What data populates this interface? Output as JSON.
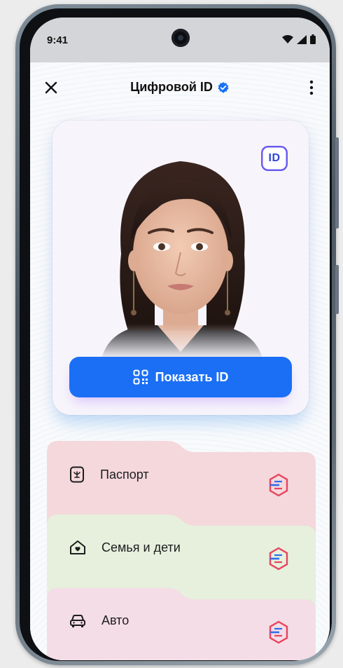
{
  "status": {
    "time": "9:41"
  },
  "header": {
    "title": "Цифровой ID"
  },
  "id_card": {
    "badge": "ID",
    "show_button_label": "Показать ID"
  },
  "documents": [
    {
      "label": "Паспорт",
      "icon": "passport-icon",
      "color": "#f4d8dc"
    },
    {
      "label": "Семья и дети",
      "icon": "family-house-icon",
      "color": "#e6f0dd"
    },
    {
      "label": "Авто",
      "icon": "car-icon",
      "color": "#f4dde6"
    }
  ],
  "colors": {
    "accent": "#1a6ff5",
    "verified": "#1a6ff5",
    "badge": "#2f45d8"
  }
}
